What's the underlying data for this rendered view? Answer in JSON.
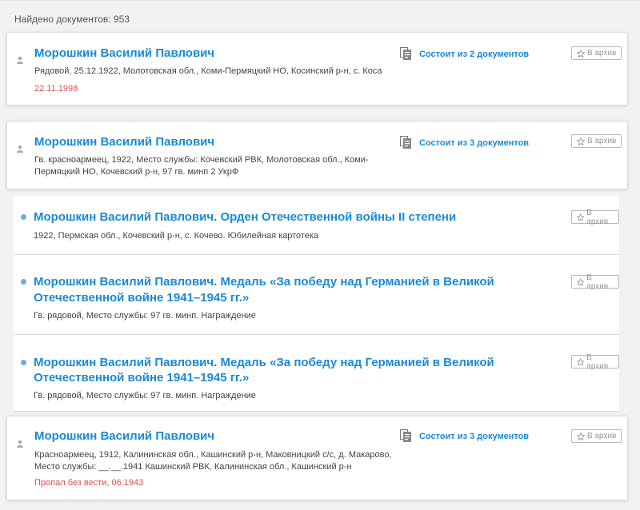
{
  "results": {
    "count_text": "Найдено документов: 953"
  },
  "archive_label": "В архив",
  "items": [
    {
      "title": "Морошкин Василий Павлович",
      "desc1": "Рядовой, 25.12.1922, Молотовская обл., Коми-Пермяцкий НО, Косинский р-н, с. Коса",
      "desc2": "",
      "date": "22.11.1998",
      "docs": "Состоит из 2 документов"
    },
    {
      "title": "Морошкин Василий Павлович",
      "desc1": "Гв. красноармеец, 1922, Место службы: Кочевский РВК, Молотовская обл., Коми-",
      "desc2": "Пермяцкий НО, Кочевский р-н, 97 гв. минп 2 УкрФ",
      "docs": "Состоит из 3 документов"
    },
    {
      "title": "Морошкин Василий Павлович. Орден Отечественной войны II степени",
      "desc1": "1922, Пермская обл., Кочевский р-н, с. Кочево. Юбилейная картотека"
    },
    {
      "title1": "Морошкин Василий Павлович. Медаль «За победу над Германией в Великой",
      "title2": "Отечественной войне 1941–1945 гг.»",
      "desc1": "Гв. рядовой, Место службы: 97 гв. минп. Награждение"
    },
    {
      "title1": "Морошкин Василий Павлович. Медаль «За победу над Германией в Великой",
      "title2": "Отечественной войне 1941–1945 гг.»",
      "desc1": "Гв. рядовой, Место службы: 97 гв. минп. Награждение"
    },
    {
      "title": "Морошкин Василий Павлович",
      "desc1": "Красноармеец, 1912, Калининская обл., Кашинский р-н, Маковницкий с/с, д. Макарово,",
      "desc2": "Место службы: __.__.1941 Кашинский РВК, Калининская обл., Кашинский р-н",
      "date": "Пропал без вести, 06.1943",
      "docs": "Состоит из 3 документов"
    }
  ]
}
